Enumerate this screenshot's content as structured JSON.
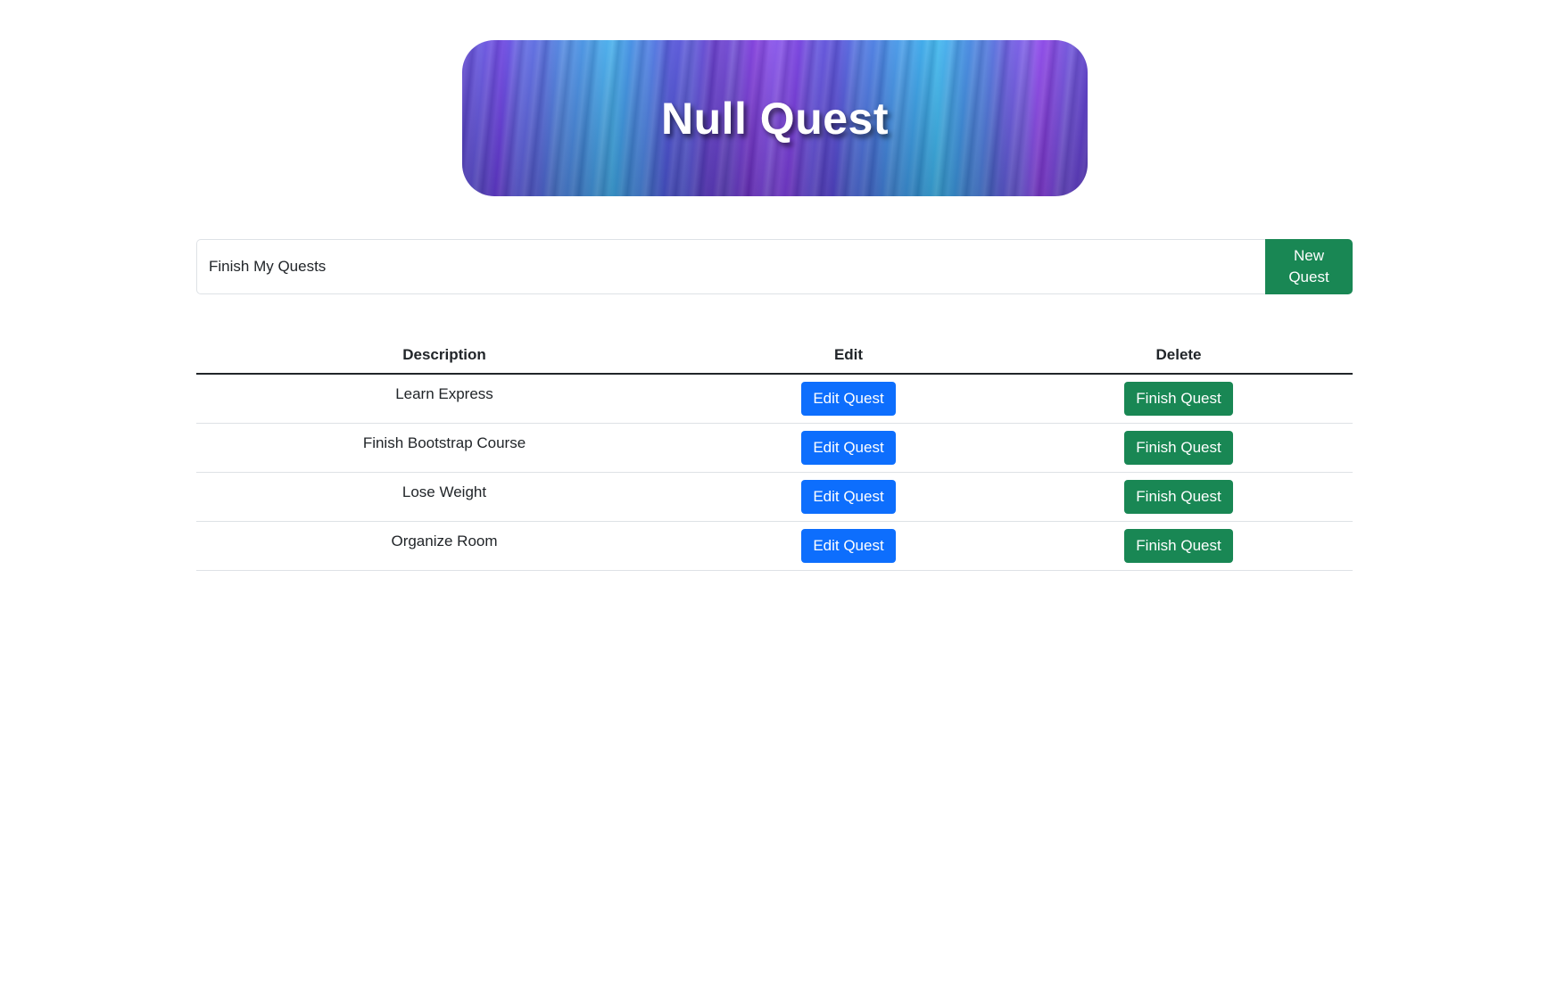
{
  "header": {
    "title": "Null Quest"
  },
  "new_quest": {
    "input_value": "Finish My Quests",
    "button_label": "New Quest"
  },
  "table": {
    "columns": [
      "Description",
      "Edit",
      "Delete"
    ],
    "rows": [
      {
        "description": "Learn Express",
        "edit_label": "Edit Quest",
        "delete_label": "Finish Quest"
      },
      {
        "description": "Finish Bootstrap Course",
        "edit_label": "Edit Quest",
        "delete_label": "Finish Quest"
      },
      {
        "description": "Lose Weight",
        "edit_label": "Edit Quest",
        "delete_label": "Finish Quest"
      },
      {
        "description": "Organize Room",
        "edit_label": "Edit Quest",
        "delete_label": "Finish Quest"
      }
    ]
  },
  "colors": {
    "primary": "#0d6efd",
    "success": "#198754",
    "border": "#dee2e6"
  }
}
